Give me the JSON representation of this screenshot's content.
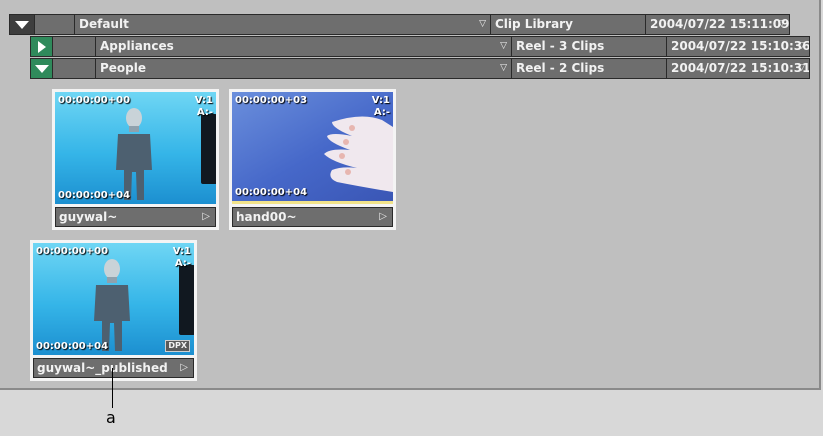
{
  "library_tree": {
    "root": {
      "name": "Default",
      "type": "Clip Library",
      "date": "2004/07/22 15:11:09",
      "dropdown_glyph": "▽"
    },
    "reels": [
      {
        "name": "Appliances",
        "type": "Reel - 3 Clips",
        "date": "2004/07/22 15:10:36",
        "expanded": false
      },
      {
        "name": "People",
        "type": "Reel - 2 Clips",
        "date": "2004/07/22 15:10:31",
        "expanded": true
      }
    ]
  },
  "clips": [
    {
      "name": "guywal~",
      "tc_start": "00:00:00+00",
      "tc_end": "00:00:00+04",
      "video": "V:1",
      "audio": "A:-",
      "play_glyph": "▷"
    },
    {
      "name": "hand00~",
      "tc_start": "00:00:00+03",
      "tc_end": "00:00:00+04",
      "video": "V:1",
      "audio": "A:-",
      "play_glyph": "▷"
    },
    {
      "name": "guywal~_published",
      "tc_start": "00:00:00+00",
      "tc_end": "00:00:00+04",
      "video": "V:1",
      "audio": "A:-",
      "badge": "DPX",
      "play_glyph": "▷"
    }
  ],
  "callout": {
    "label": "a"
  },
  "colors": {
    "panel_bg": "#bfbfbf",
    "row_bg": "#6e6e6e",
    "expander_green": "#2f8a5b",
    "thumb_sky": "#35b5e8",
    "thumb_hand": "#4668c9"
  }
}
